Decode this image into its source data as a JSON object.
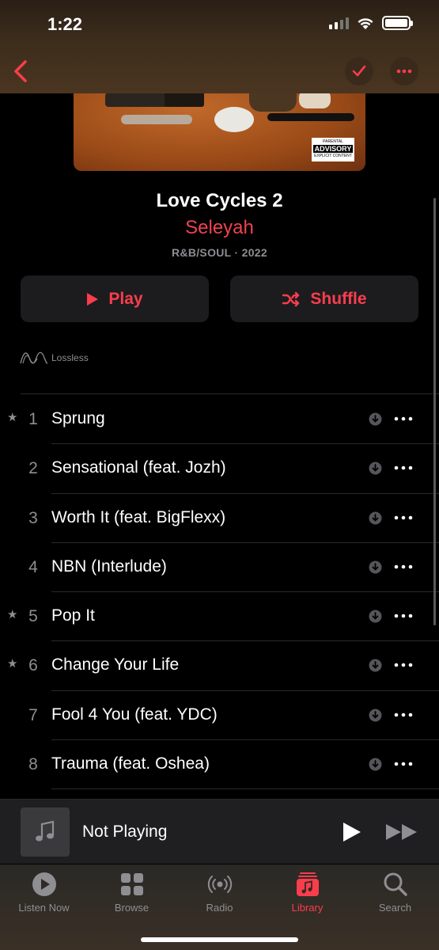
{
  "status_bar": {
    "time": "1:22"
  },
  "header": {
    "back_icon": "chevron-left-icon",
    "check_icon": "checkmark-icon",
    "more_icon": "ellipsis-icon"
  },
  "artwork": {
    "advisory_top": "PARENTAL",
    "advisory_main": "ADVISORY",
    "advisory_bottom": "EXPLICIT CONTENT"
  },
  "album": {
    "title": "Love Cycles 2",
    "artist": "Seleyah",
    "meta": "R&B/SOUL · 2022"
  },
  "actions": {
    "play_label": "Play",
    "shuffle_label": "Shuffle"
  },
  "badge": {
    "lossless_label": "Lossless"
  },
  "tracks": [
    {
      "num": "1",
      "title": "Sprung",
      "starred": true
    },
    {
      "num": "2",
      "title": "Sensational (feat. Jozh)",
      "starred": false
    },
    {
      "num": "3",
      "title": "Worth It (feat. BigFlexx)",
      "starred": false
    },
    {
      "num": "4",
      "title": "NBN (Interlude)",
      "starred": false
    },
    {
      "num": "5",
      "title": "Pop It",
      "starred": true
    },
    {
      "num": "6",
      "title": "Change Your Life",
      "starred": true
    },
    {
      "num": "7",
      "title": "Fool 4 You (feat. YDC)",
      "starred": false
    },
    {
      "num": "8",
      "title": "Trauma (feat. Oshea)",
      "starred": false
    }
  ],
  "mini_player": {
    "title": "Not Playing"
  },
  "tabs": [
    {
      "label": "Listen Now",
      "icon": "play-circle-icon",
      "active": false
    },
    {
      "label": "Browse",
      "icon": "grid-icon",
      "active": false
    },
    {
      "label": "Radio",
      "icon": "radio-icon",
      "active": false
    },
    {
      "label": "Library",
      "icon": "library-icon",
      "active": true
    },
    {
      "label": "Search",
      "icon": "search-icon",
      "active": false
    }
  ],
  "colors": {
    "accent": "#fa3d4c",
    "background": "#000000",
    "secondary_text": "#8e8e93"
  }
}
